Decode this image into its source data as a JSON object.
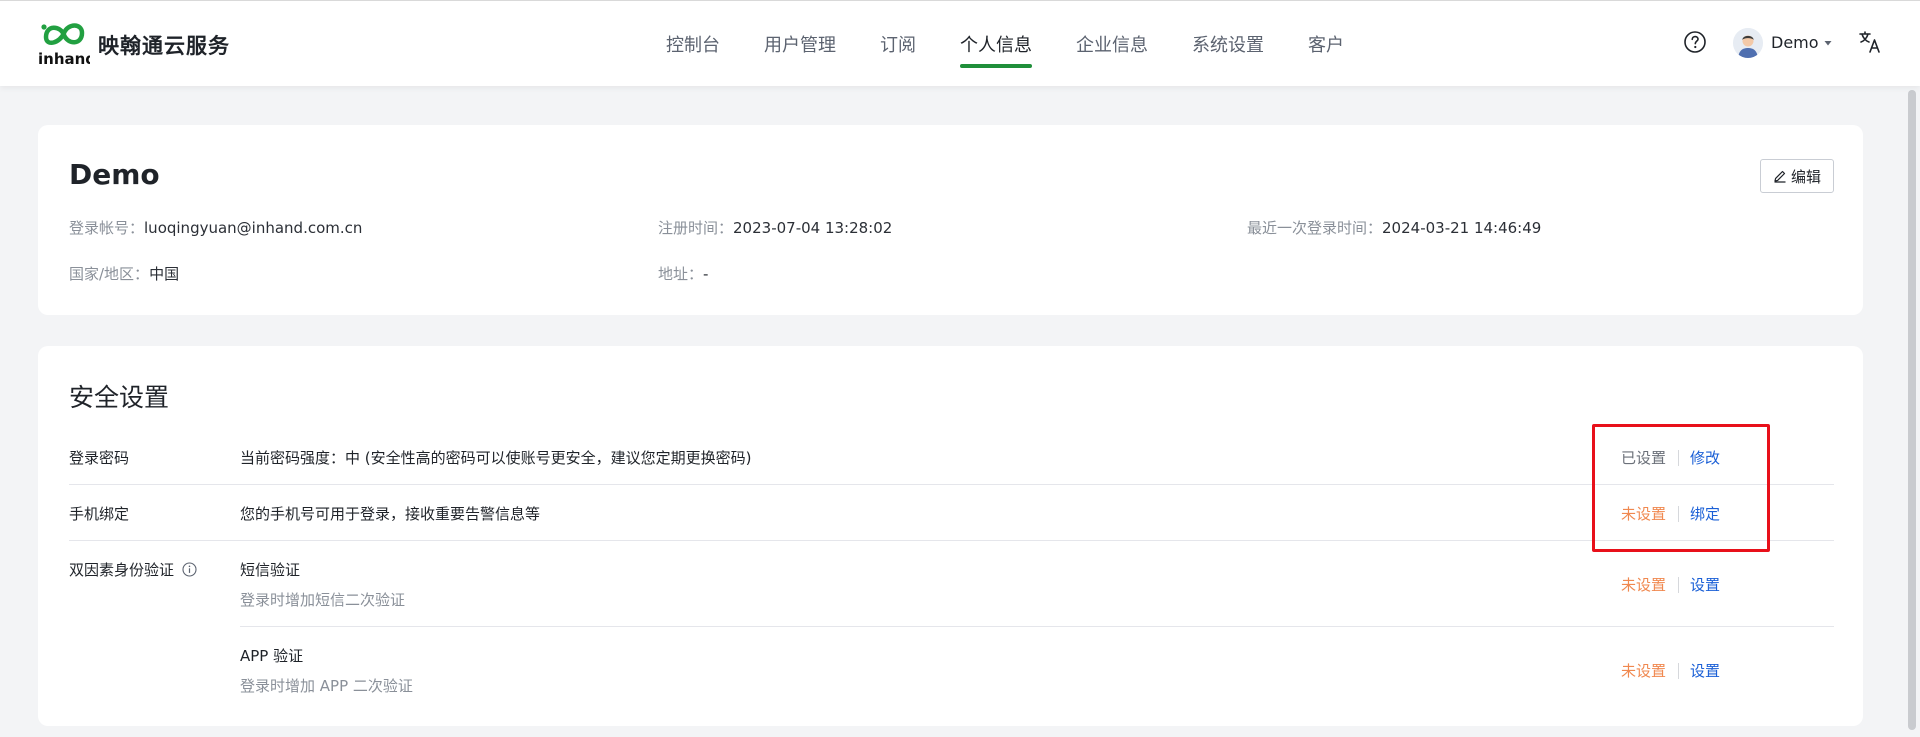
{
  "header": {
    "brand": "映翰通云服务",
    "logo_text": "inhand",
    "nav": [
      "控制台",
      "用户管理",
      "订阅",
      "个人信息",
      "企业信息",
      "系统设置",
      "客户"
    ],
    "active_nav": "个人信息",
    "user": "Demo",
    "icons": [
      "help-circle-icon",
      "avatar-icon",
      "caret-down-icon",
      "translate-icon"
    ]
  },
  "profile": {
    "name": "Demo",
    "edit_label": "编辑",
    "account_label": "登录帐号：",
    "account_value": "luoqingyuan@inhand.com.cn",
    "register_label": "注册时间：",
    "register_value": "2023-07-04 13:28:02",
    "last_login_label": "最近一次登录时间：",
    "last_login_value": "2024-03-21 14:46:49",
    "region_label": "国家/地区：",
    "region_value": "中国",
    "address_label": "地址：",
    "address_value": "-"
  },
  "security": {
    "title": "安全设置",
    "password": {
      "label": "登录密码",
      "desc": "当前密码强度：中 (安全性高的密码可以使账号更安全，建议您定期更换密码)",
      "status": "已设置",
      "action": "修改"
    },
    "phone": {
      "label": "手机绑定",
      "desc": "您的手机号可用于登录，接收重要告警信息等",
      "status": "未设置",
      "action": "绑定"
    },
    "twofa": {
      "label": "双因素身份验证",
      "sms_title": "短信验证",
      "sms_desc": "登录时增加短信二次验证",
      "sms_status": "未设置",
      "sms_action": "设置",
      "app_title": "APP 验证",
      "app_desc": "登录时增加 APP 二次验证",
      "app_status": "未设置",
      "app_action": "设置"
    }
  },
  "colors": {
    "accent_green": "#1f8f3a",
    "link_blue": "#1a5fd6",
    "unset_orange": "#f0884f",
    "highlight_red": "#e8101a"
  }
}
